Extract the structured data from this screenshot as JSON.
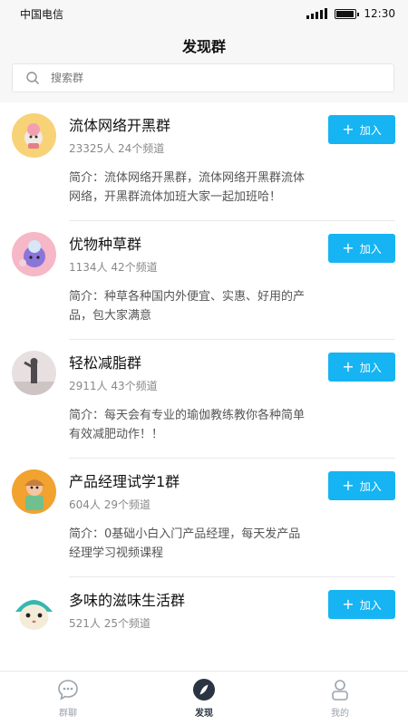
{
  "status": {
    "carrier": "中国电信",
    "time": "12:30",
    "battery_level": 0.85
  },
  "nav": {
    "title": "发现群"
  },
  "search": {
    "placeholder": "搜索群",
    "icon": "search-icon"
  },
  "groups": [
    {
      "name": "流体网络开黑群",
      "members": "23325人",
      "channels": "24个频道",
      "desc": "简介：流体网络开黑群，流体网络开黑群流体网络，开黑群流体加班大家一起加班哈！",
      "join_label": "加入"
    },
    {
      "name": "优物种草群",
      "members": "1134人",
      "channels": "42个频道",
      "desc": "简介：种草各种国内外便宜、实惠、好用的产品，包大家满意",
      "join_label": "加入"
    },
    {
      "name": "轻松减脂群",
      "members": "2911人",
      "channels": "43个频道",
      "desc": "简介：每天会有专业的瑜伽教练教你各种简单有效减肥动作！！",
      "join_label": "加入"
    },
    {
      "name": "产品经理试学1群",
      "members": "604人",
      "channels": "29个频道",
      "desc": "简介：0基础小白入门产品经理，每天发产品经理学习视频课程",
      "join_label": "加入"
    },
    {
      "name": "多味的滋味生活群",
      "members": "521人",
      "channels": "25个频道",
      "desc": "",
      "join_label": "加入"
    }
  ],
  "tabs": [
    {
      "label": "群聊",
      "icon": "chat-bubble-icon",
      "active": false
    },
    {
      "label": "发现",
      "icon": "compass-icon",
      "active": true
    },
    {
      "label": "我的",
      "icon": "person-icon",
      "active": false
    }
  ],
  "colors": {
    "accent": "#16b4f2",
    "active_tab": "#2a3442",
    "inactive_tab": "#9aa3ad"
  }
}
